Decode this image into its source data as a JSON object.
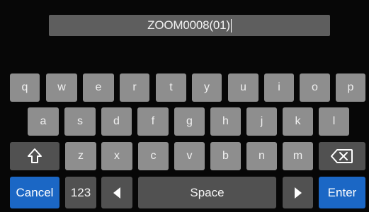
{
  "input": {
    "value": "ZOOM0008(01)"
  },
  "keyboard": {
    "row1": [
      "q",
      "w",
      "e",
      "r",
      "t",
      "y",
      "u",
      "i",
      "o",
      "p"
    ],
    "row2": [
      "a",
      "s",
      "d",
      "f",
      "g",
      "h",
      "j",
      "k",
      "l"
    ],
    "row3": [
      "z",
      "x",
      "c",
      "v",
      "b",
      "n",
      "m"
    ],
    "bottom": {
      "cancel": "Cancel",
      "numbers": "123",
      "space": "Space",
      "enter": "Enter"
    },
    "icons": {
      "shift": "shift-up-arrow-icon",
      "backspace": "backspace-icon",
      "left": "cursor-left-icon",
      "right": "cursor-right-icon"
    }
  },
  "colors": {
    "background": "#070707",
    "key": "#8e8e8e",
    "key_dark": "#515151",
    "accent": "#1b67c5",
    "field": "#5e5e5e"
  }
}
